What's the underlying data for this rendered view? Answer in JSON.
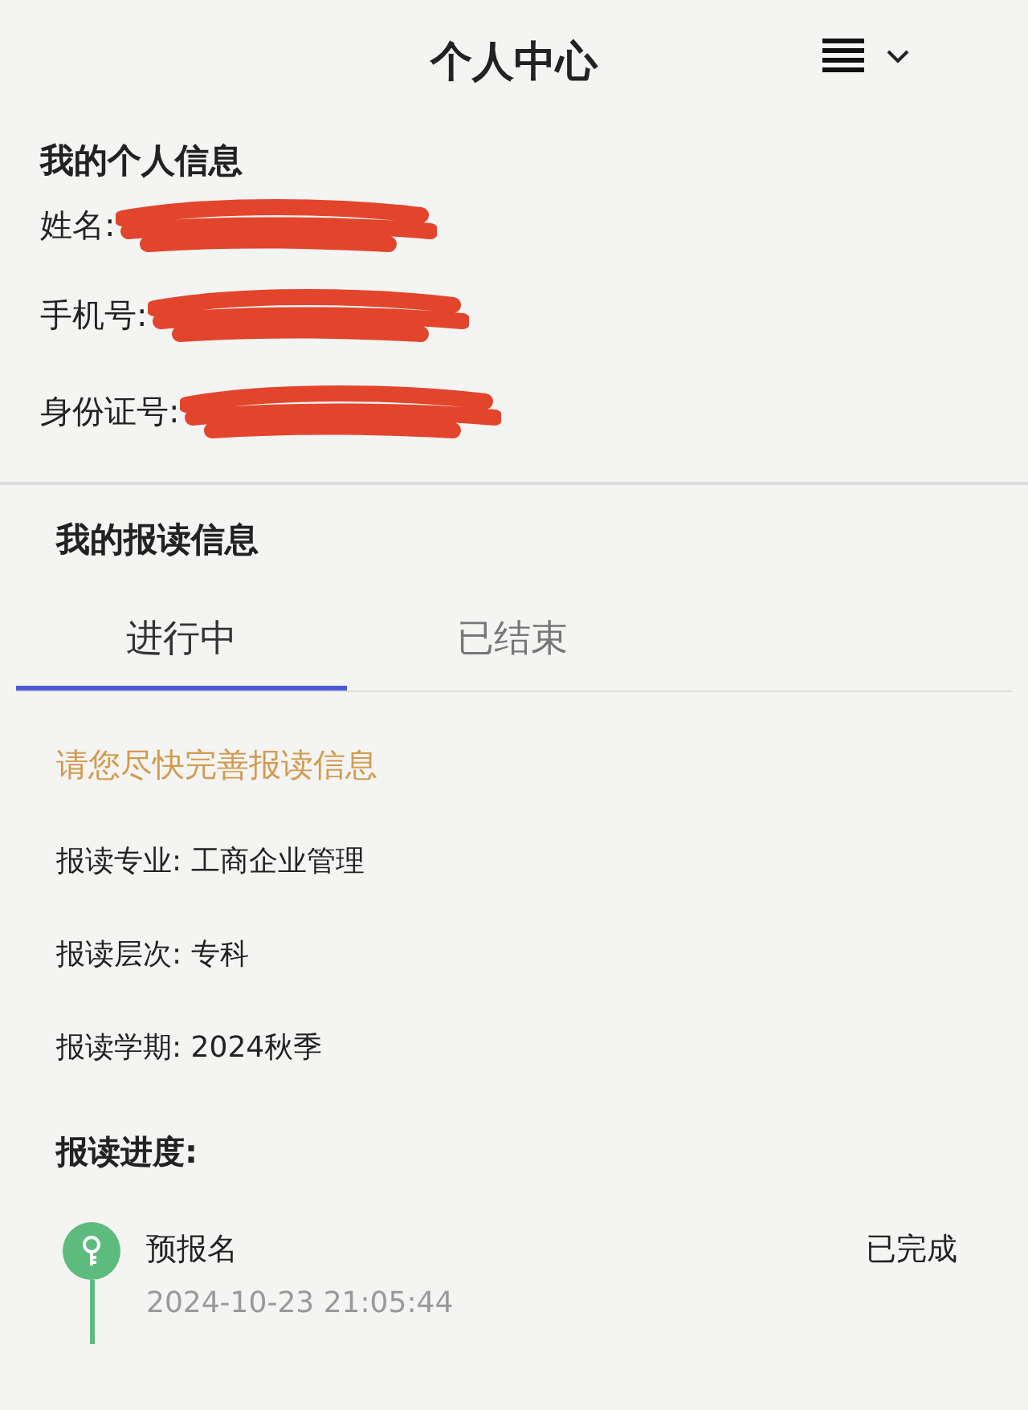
{
  "header": {
    "title": "个人中心"
  },
  "personal_info": {
    "heading": "我的个人信息",
    "fields": [
      {
        "label": "姓名:",
        "redacted": true
      },
      {
        "label": "手机号:",
        "redacted": true
      },
      {
        "label": "身份证号:",
        "redacted": true
      }
    ]
  },
  "enrollment": {
    "heading": "我的报读信息",
    "tabs": [
      {
        "label": "进行中",
        "selected": true
      },
      {
        "label": "已结束",
        "selected": false
      }
    ],
    "notice": "请您尽快完善报读信息",
    "details": [
      "报读专业: 工商企业管理",
      "报读层次: 专科",
      "报读学期: 2024秋季"
    ],
    "progress_heading": "报读进度:",
    "steps": [
      {
        "name": "预报名",
        "time": "2024-10-23 21:05:44",
        "status": "已完成",
        "done": true
      }
    ]
  }
}
